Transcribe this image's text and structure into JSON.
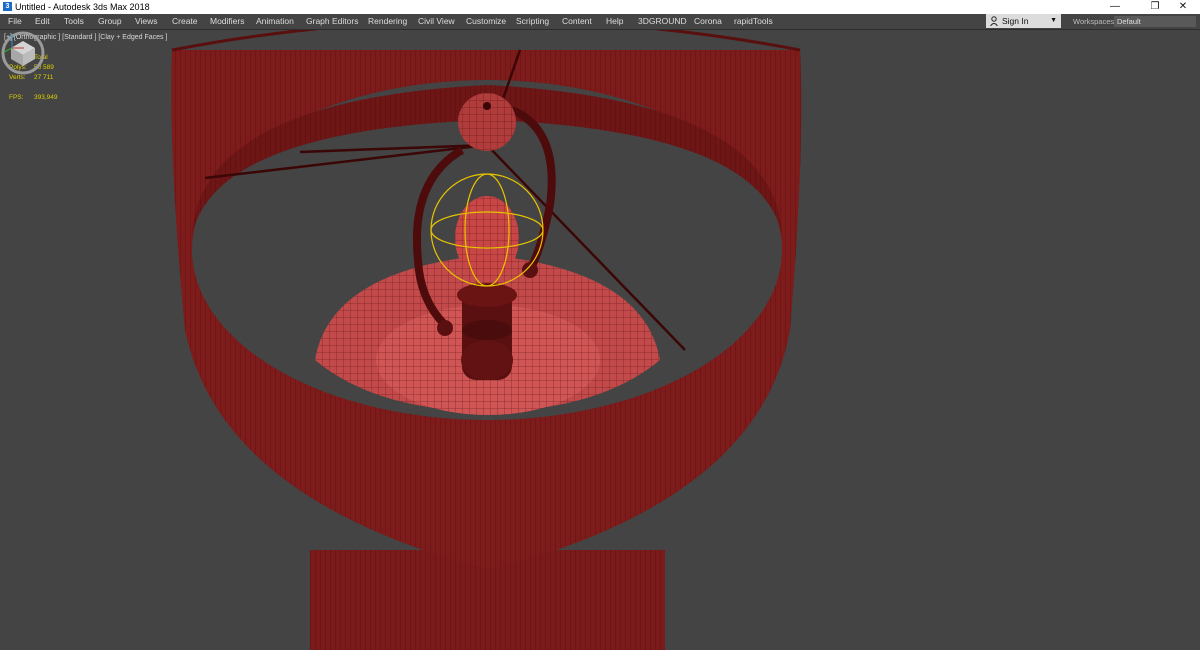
{
  "window": {
    "title": "Untitled - Autodesk 3ds Max 2018",
    "app_icon": "3ds-max-icon",
    "controls": [
      "minimize-icon",
      "restore-icon",
      "close-icon"
    ]
  },
  "menubar": {
    "items": [
      "File",
      "Edit",
      "Tools",
      "Group",
      "Views",
      "Create",
      "Modifiers",
      "Animation",
      "Graph Editors",
      "Rendering",
      "Civil View",
      "Customize",
      "Scripting",
      "Content",
      "Help",
      "3DGROUND",
      "Corona",
      "rapidTools"
    ]
  },
  "signin": {
    "label": "Sign In",
    "icon": "user-icon"
  },
  "workspaces": {
    "label": "Workspaces:",
    "value": "Default"
  },
  "viewport": {
    "label": "[+] [Orthographic ] [Standard ] [Clay + Edged Faces ]",
    "stats": {
      "header": "Total",
      "polys_label": "Polys:",
      "polys": "50 589",
      "verts_label": "Verts:",
      "verts": "27 711",
      "fps_label": "FPS:",
      "fps": "393,949"
    },
    "colors": {
      "background": "#444444",
      "mesh": "#8a1f1f",
      "wire": "#3f0808",
      "selection": "#e8c400",
      "stats": "#dcd000"
    }
  }
}
